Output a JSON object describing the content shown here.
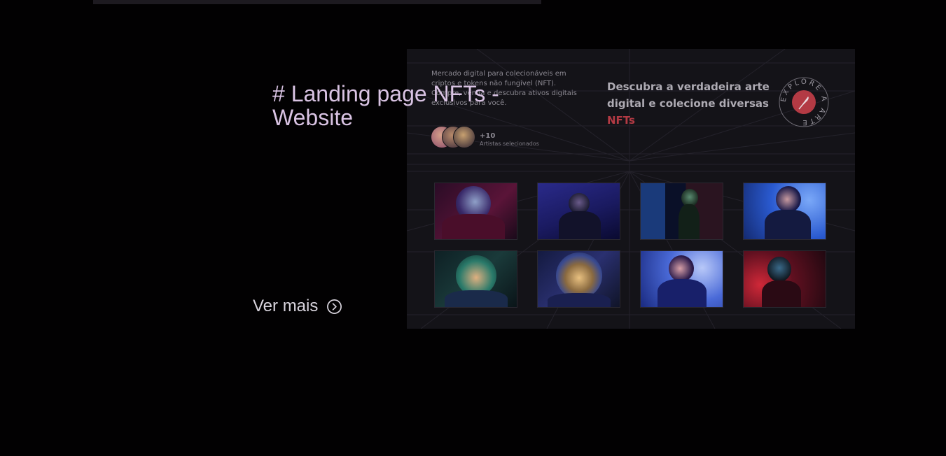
{
  "project": {
    "title": "# Landing page NFTs - Website",
    "cta_label": "Ver mais",
    "cta_icon": "chevron-right-circle-icon"
  },
  "preview": {
    "description": "Mercado digital para colecionáveis em criptos e tokens não fungível (NFT). Compre, venda e descubra ativos digitais exclusivos para você.",
    "artists_count": "+10",
    "artists_label": "Artistas selecionados",
    "heading": "Descubra a verdadeira arte digital e colecione diversas",
    "heading_accent": "NFTs",
    "badge_text": "EXPLORE A ARTE",
    "badge_icon": "feather-icon",
    "accent_color": "#b33a44",
    "thumbnails": [
      {
        "name": "astronaut-red-helmet",
        "bg": "#3b1030",
        "glow": "#c2264e"
      },
      {
        "name": "astronaut-blue-street",
        "bg": "#1c1f6e",
        "glow": "#4b3fa8"
      },
      {
        "name": "astronaut-city-night",
        "bg": "#101a3a",
        "glow": "#2b5fa0"
      },
      {
        "name": "astronaut-blue-lights",
        "bg": "#1e3fa8",
        "glow": "#6aa0f0"
      },
      {
        "name": "astronaut-green-visor",
        "bg": "#142a2a",
        "glow": "#2a8a7a"
      },
      {
        "name": "astronaut-portrait-visor",
        "bg": "#1a2050",
        "glow": "#d0a060"
      },
      {
        "name": "astronaut-building-bokeh",
        "bg": "#1a3aa0",
        "glow": "#9ab8ff"
      },
      {
        "name": "astronaut-red-neon",
        "bg": "#401018",
        "glow": "#d02838"
      }
    ]
  }
}
